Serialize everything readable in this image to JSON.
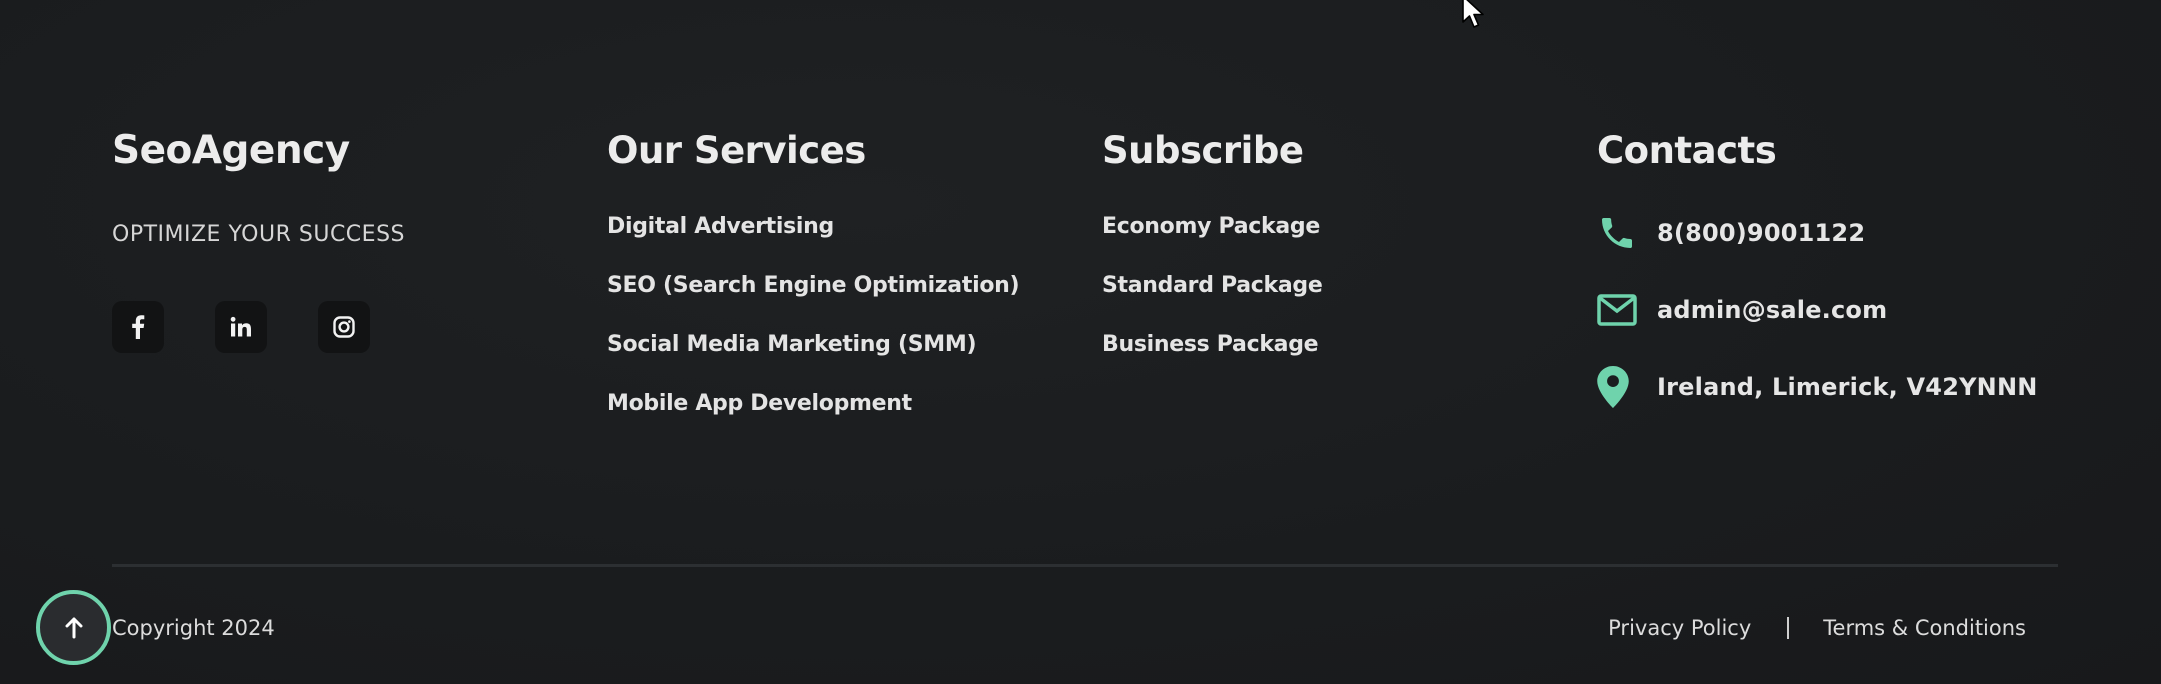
{
  "brand": {
    "name": "SeoAgency",
    "tagline": "OPTIMIZE YOUR SUCCESS",
    "social_icons": [
      "facebook-icon",
      "linkedin-icon",
      "instagram-icon"
    ]
  },
  "services": {
    "heading": "Our Services",
    "items": [
      {
        "label": "Digital Advertising"
      },
      {
        "label": "SEO (Search Engine Optimization)"
      },
      {
        "label": "Social Media Marketing (SMM)"
      },
      {
        "label": "Mobile App Development"
      }
    ]
  },
  "subscribe": {
    "heading": "Subscribe",
    "items": [
      {
        "label": "Economy Package"
      },
      {
        "label": "Standard Package"
      },
      {
        "label": "Business Package"
      }
    ]
  },
  "contacts": {
    "heading": "Contacts",
    "phone": "8(800)9001122",
    "email": "admin@sale.com",
    "address": "Ireland, Limerick, V42YNNN"
  },
  "bottom": {
    "copyright": "Copyright 2024",
    "privacy": "Privacy Policy",
    "terms": "Terms & Conditions"
  },
  "colors": {
    "background": "#1b1d1f",
    "accent": "#6fd3ac",
    "text": "#e9e9e9"
  }
}
